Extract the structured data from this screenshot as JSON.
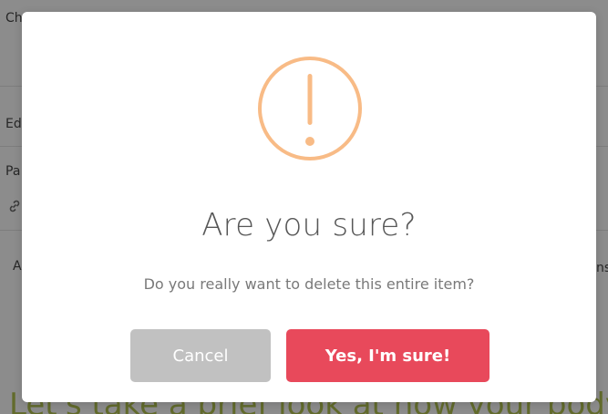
{
  "background": {
    "row1_text": "Ch",
    "row2_text": "Ed",
    "row3_text": "Pa",
    "row4_text": "A",
    "row4_right_text": "ns",
    "heading_text": "Let's take a brief look at how your body"
  },
  "dialog": {
    "icon": "exclamation-circle-icon",
    "title": "Are you sure?",
    "message": "Do you really want to delete this entire item?",
    "cancel_label": "Cancel",
    "confirm_label": "Yes, I'm sure!"
  },
  "colors": {
    "warning_icon": "#f8bb86",
    "cancel_button": "#c1c1c1",
    "confirm_button": "#e8495b",
    "background_heading": "#a9b94d"
  }
}
